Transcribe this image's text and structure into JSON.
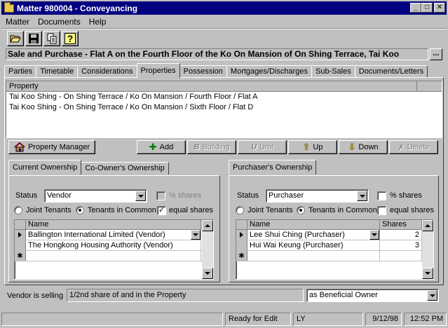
{
  "window": {
    "title": "Matter 980004 - Conveyancing",
    "controls": {
      "minimize": "_",
      "maximize": "□",
      "close": "✕"
    }
  },
  "menu": [
    "Matter",
    "Documents",
    "Help"
  ],
  "toolbar": [
    {
      "name": "open-icon"
    },
    {
      "name": "save-icon"
    },
    {
      "name": "copy-icon"
    },
    {
      "name": "help-icon",
      "glyph": "?"
    }
  ],
  "matter_title": "Sale and Purchase - Flat A on the Fourth Floor of the Ko On Mansion of On Shing Terrace, Tai Koo",
  "ellipsis_label": "...",
  "tabs": [
    "Parties",
    "Timetable",
    "Considerations",
    "Properties",
    "Possession",
    "Mortgages/Discharges",
    "Sub-Sales",
    "Documents/Letters"
  ],
  "active_tab": "Properties",
  "property_list": {
    "header": "Property",
    "rows": [
      "Tai Koo Shing - On Shing Terrace / Ko On Mansion / Fourth Floor / Flat A",
      "Tai Koo Shing - On Shing Terrace / Ko On Mansion / Sixth Floor / Flat D"
    ]
  },
  "buttons": {
    "property_manager": "Property Manager",
    "add": "Add",
    "building": "Building",
    "unit": "Unit",
    "up": "Up",
    "down": "Down",
    "delete": "Delete"
  },
  "left_tabs": [
    "Current Ownership",
    "Co-Owner's Ownership"
  ],
  "right_tabs": [
    "Purchaser's Ownership"
  ],
  "current": {
    "status_label": "Status",
    "status_value": "Vendor",
    "pct_shares_label": "% shares",
    "joint_label": "Joint Tenants",
    "common_label": "Tenants in Common",
    "equal_label": "equal shares",
    "equal_checked": "✓",
    "grid_header": "Name",
    "rows": [
      "Ballington International Limited (Vendor)",
      "The Hongkong Housing Authority (Vendor)"
    ],
    "new_row_marker": "✱"
  },
  "purchaser": {
    "status_label": "Status",
    "status_value": "Purchaser",
    "pct_shares_label": "% shares",
    "joint_label": "Joint Tenants",
    "common_label": "Tenants in Common",
    "equal_label": "equal shares",
    "grid_headers": [
      "Name",
      "Shares"
    ],
    "rows": [
      {
        "name": "Lee Shui Ching (Purchaser)",
        "shares": "2"
      },
      {
        "name": "Hui Wai Keung (Purchaser)",
        "shares": "3"
      }
    ],
    "new_row_marker": "✱"
  },
  "selling": {
    "label": "Vendor is selling",
    "value": "1/2nd share of and in the Property",
    "capacity": "as Beneficial Owner"
  },
  "status_bar": {
    "state": "Ready for Edit",
    "user": "LY",
    "date": "9/12/98",
    "time": "12:52 PM"
  }
}
